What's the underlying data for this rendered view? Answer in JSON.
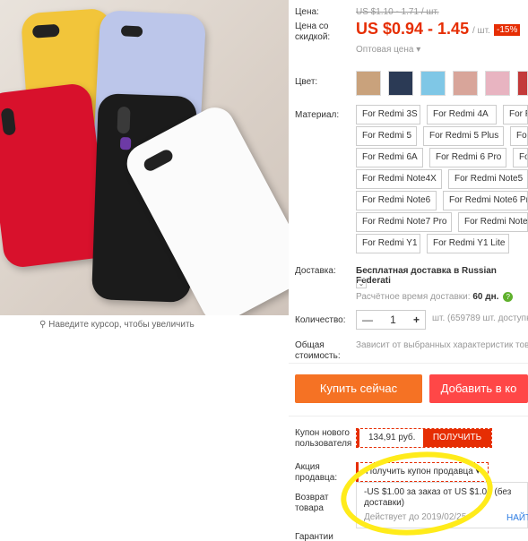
{
  "gallery": {
    "zoom_hint": "Наведите курсор, чтобы увеличить"
  },
  "price": {
    "label": "Цена:",
    "old": "US $1.10 - 1.71 / шт.",
    "discount_label": "Цена со скидкой:",
    "current": "US $0.94 - 1.45",
    "unit": "/ шт.",
    "discount_badge": "-15%",
    "wholesale": "Оптовая цена ▾"
  },
  "color": {
    "label": "Цвет:",
    "swatches": [
      "#c9a27c",
      "#2b3a55",
      "#7fc7e6",
      "#d8a59a",
      "#e8b4c1",
      "#c33a3a",
      "#7a5a3f"
    ]
  },
  "material": {
    "label": "Материал:",
    "options": [
      "For Redmi 3S",
      "For Redmi 4A",
      "For Re",
      "For Redmi 5",
      "For Redmi 5 Plus",
      "For",
      "For Redmi 6A",
      "For Redmi 6 Pro",
      "For",
      "For Redmi Note4X",
      "For Redmi Note5",
      "For Redmi Note6",
      "For Redmi Note6 Pro",
      "For Redmi Note7 Pro",
      "For Redmi Note",
      "For Redmi Y1",
      "For Redmi Y1 Lite"
    ]
  },
  "delivery": {
    "label": "Доставка:",
    "value": "Бесплатная доставка в Russian Federati",
    "estimate_label": "Расчётное время доставки:",
    "estimate_value": "60 дн.",
    "help": "?"
  },
  "quantity": {
    "label": "Количество:",
    "minus": "—",
    "value": "1",
    "plus": "+",
    "available": "шт. (659789 шт. доступн"
  },
  "total": {
    "label": "Общая стоимость:",
    "value": "Зависит от выбранных характеристик тов"
  },
  "actions": {
    "buy_now": "Купить сейчас",
    "add_to_cart": "Добавить в ко",
    "buy_color": "#f57224",
    "cart_color": "#ff4747"
  },
  "new_user_coupon": {
    "label": "Купон нового пользователя",
    "amount": "134,91 руб.",
    "get": "ПОЛУЧИТЬ"
  },
  "seller_promo": {
    "label": "Акция продавца:",
    "button": "Получить купон продавца ▾",
    "offer": "-US $1.00 за заказ от US $1.01 (без доставки)",
    "valid": "Действует до 2019/02/25",
    "find": "НАЙТ"
  },
  "returns": {
    "label": "Возврат товара"
  },
  "guarantee": {
    "label": "Гарантии"
  }
}
